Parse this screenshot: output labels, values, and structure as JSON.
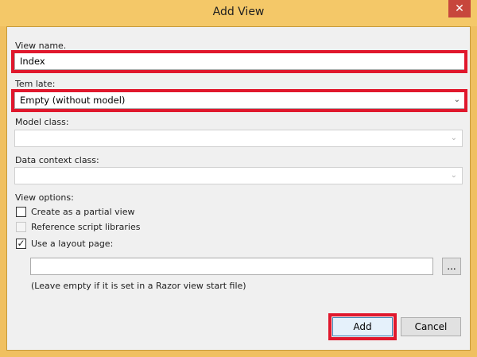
{
  "window": {
    "title": "Add View",
    "close_icon": "close-icon"
  },
  "form": {
    "view_name_label": "View name.",
    "view_name_value": "Index",
    "template_label": "Tem late:",
    "template_value": "Empty (without model)",
    "model_class_label": "Model class:",
    "model_class_value": "",
    "data_context_label": "Data context class:",
    "data_context_value": "",
    "view_options_label": "View options:",
    "partial_view_label": "Create as a partial view",
    "partial_view_checked": false,
    "script_libraries_label": "Reference script libraries",
    "script_libraries_checked": false,
    "layout_page_label": "Use a layout page:",
    "layout_page_checked": true,
    "layout_page_value": "",
    "browse_label": "...",
    "layout_hint": "(Leave empty if it is set in a Razor view start file)"
  },
  "buttons": {
    "add_label": "Add",
    "cancel_label": "Cancel"
  },
  "colors": {
    "titlebar": "#f4c868",
    "highlight": "#e0182d",
    "close_button": "#c7463c"
  }
}
